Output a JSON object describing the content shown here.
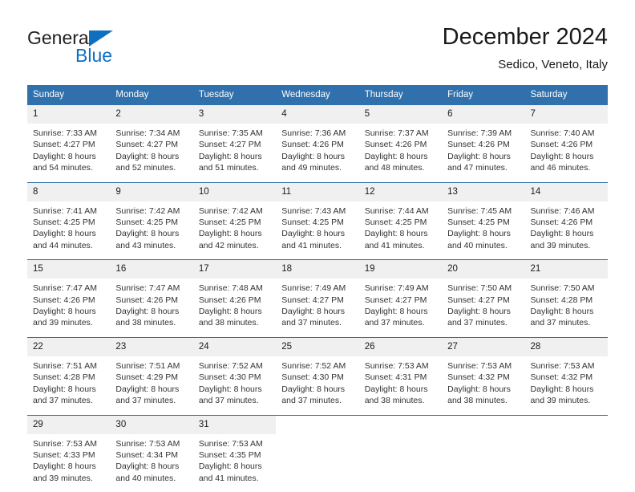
{
  "brand": {
    "name_top": "General",
    "name_bottom": "Blue",
    "triangle_color": "#0f6fc0"
  },
  "header": {
    "title": "December 2024",
    "subtitle": "Sedico, Veneto, Italy"
  },
  "theme": {
    "header_blue": "#3071ad",
    "day_number_band": "#f0f0f0",
    "text": "#333333"
  },
  "calendar": {
    "weekday_headers": [
      "Sunday",
      "Monday",
      "Tuesday",
      "Wednesday",
      "Thursday",
      "Friday",
      "Saturday"
    ],
    "weeks": [
      [
        {
          "day": "1",
          "sunrise": "Sunrise: 7:33 AM",
          "sunset": "Sunset: 4:27 PM",
          "daylight_1": "Daylight: 8 hours",
          "daylight_2": "and 54 minutes."
        },
        {
          "day": "2",
          "sunrise": "Sunrise: 7:34 AM",
          "sunset": "Sunset: 4:27 PM",
          "daylight_1": "Daylight: 8 hours",
          "daylight_2": "and 52 minutes."
        },
        {
          "day": "3",
          "sunrise": "Sunrise: 7:35 AM",
          "sunset": "Sunset: 4:27 PM",
          "daylight_1": "Daylight: 8 hours",
          "daylight_2": "and 51 minutes."
        },
        {
          "day": "4",
          "sunrise": "Sunrise: 7:36 AM",
          "sunset": "Sunset: 4:26 PM",
          "daylight_1": "Daylight: 8 hours",
          "daylight_2": "and 49 minutes."
        },
        {
          "day": "5",
          "sunrise": "Sunrise: 7:37 AM",
          "sunset": "Sunset: 4:26 PM",
          "daylight_1": "Daylight: 8 hours",
          "daylight_2": "and 48 minutes."
        },
        {
          "day": "6",
          "sunrise": "Sunrise: 7:39 AM",
          "sunset": "Sunset: 4:26 PM",
          "daylight_1": "Daylight: 8 hours",
          "daylight_2": "and 47 minutes."
        },
        {
          "day": "7",
          "sunrise": "Sunrise: 7:40 AM",
          "sunset": "Sunset: 4:26 PM",
          "daylight_1": "Daylight: 8 hours",
          "daylight_2": "and 46 minutes."
        }
      ],
      [
        {
          "day": "8",
          "sunrise": "Sunrise: 7:41 AM",
          "sunset": "Sunset: 4:25 PM",
          "daylight_1": "Daylight: 8 hours",
          "daylight_2": "and 44 minutes."
        },
        {
          "day": "9",
          "sunrise": "Sunrise: 7:42 AM",
          "sunset": "Sunset: 4:25 PM",
          "daylight_1": "Daylight: 8 hours",
          "daylight_2": "and 43 minutes."
        },
        {
          "day": "10",
          "sunrise": "Sunrise: 7:42 AM",
          "sunset": "Sunset: 4:25 PM",
          "daylight_1": "Daylight: 8 hours",
          "daylight_2": "and 42 minutes."
        },
        {
          "day": "11",
          "sunrise": "Sunrise: 7:43 AM",
          "sunset": "Sunset: 4:25 PM",
          "daylight_1": "Daylight: 8 hours",
          "daylight_2": "and 41 minutes."
        },
        {
          "day": "12",
          "sunrise": "Sunrise: 7:44 AM",
          "sunset": "Sunset: 4:25 PM",
          "daylight_1": "Daylight: 8 hours",
          "daylight_2": "and 41 minutes."
        },
        {
          "day": "13",
          "sunrise": "Sunrise: 7:45 AM",
          "sunset": "Sunset: 4:25 PM",
          "daylight_1": "Daylight: 8 hours",
          "daylight_2": "and 40 minutes."
        },
        {
          "day": "14",
          "sunrise": "Sunrise: 7:46 AM",
          "sunset": "Sunset: 4:26 PM",
          "daylight_1": "Daylight: 8 hours",
          "daylight_2": "and 39 minutes."
        }
      ],
      [
        {
          "day": "15",
          "sunrise": "Sunrise: 7:47 AM",
          "sunset": "Sunset: 4:26 PM",
          "daylight_1": "Daylight: 8 hours",
          "daylight_2": "and 39 minutes."
        },
        {
          "day": "16",
          "sunrise": "Sunrise: 7:47 AM",
          "sunset": "Sunset: 4:26 PM",
          "daylight_1": "Daylight: 8 hours",
          "daylight_2": "and 38 minutes."
        },
        {
          "day": "17",
          "sunrise": "Sunrise: 7:48 AM",
          "sunset": "Sunset: 4:26 PM",
          "daylight_1": "Daylight: 8 hours",
          "daylight_2": "and 38 minutes."
        },
        {
          "day": "18",
          "sunrise": "Sunrise: 7:49 AM",
          "sunset": "Sunset: 4:27 PM",
          "daylight_1": "Daylight: 8 hours",
          "daylight_2": "and 37 minutes."
        },
        {
          "day": "19",
          "sunrise": "Sunrise: 7:49 AM",
          "sunset": "Sunset: 4:27 PM",
          "daylight_1": "Daylight: 8 hours",
          "daylight_2": "and 37 minutes."
        },
        {
          "day": "20",
          "sunrise": "Sunrise: 7:50 AM",
          "sunset": "Sunset: 4:27 PM",
          "daylight_1": "Daylight: 8 hours",
          "daylight_2": "and 37 minutes."
        },
        {
          "day": "21",
          "sunrise": "Sunrise: 7:50 AM",
          "sunset": "Sunset: 4:28 PM",
          "daylight_1": "Daylight: 8 hours",
          "daylight_2": "and 37 minutes."
        }
      ],
      [
        {
          "day": "22",
          "sunrise": "Sunrise: 7:51 AM",
          "sunset": "Sunset: 4:28 PM",
          "daylight_1": "Daylight: 8 hours",
          "daylight_2": "and 37 minutes."
        },
        {
          "day": "23",
          "sunrise": "Sunrise: 7:51 AM",
          "sunset": "Sunset: 4:29 PM",
          "daylight_1": "Daylight: 8 hours",
          "daylight_2": "and 37 minutes."
        },
        {
          "day": "24",
          "sunrise": "Sunrise: 7:52 AM",
          "sunset": "Sunset: 4:30 PM",
          "daylight_1": "Daylight: 8 hours",
          "daylight_2": "and 37 minutes."
        },
        {
          "day": "25",
          "sunrise": "Sunrise: 7:52 AM",
          "sunset": "Sunset: 4:30 PM",
          "daylight_1": "Daylight: 8 hours",
          "daylight_2": "and 37 minutes."
        },
        {
          "day": "26",
          "sunrise": "Sunrise: 7:53 AM",
          "sunset": "Sunset: 4:31 PM",
          "daylight_1": "Daylight: 8 hours",
          "daylight_2": "and 38 minutes."
        },
        {
          "day": "27",
          "sunrise": "Sunrise: 7:53 AM",
          "sunset": "Sunset: 4:32 PM",
          "daylight_1": "Daylight: 8 hours",
          "daylight_2": "and 38 minutes."
        },
        {
          "day": "28",
          "sunrise": "Sunrise: 7:53 AM",
          "sunset": "Sunset: 4:32 PM",
          "daylight_1": "Daylight: 8 hours",
          "daylight_2": "and 39 minutes."
        }
      ],
      [
        {
          "day": "29",
          "sunrise": "Sunrise: 7:53 AM",
          "sunset": "Sunset: 4:33 PM",
          "daylight_1": "Daylight: 8 hours",
          "daylight_2": "and 39 minutes."
        },
        {
          "day": "30",
          "sunrise": "Sunrise: 7:53 AM",
          "sunset": "Sunset: 4:34 PM",
          "daylight_1": "Daylight: 8 hours",
          "daylight_2": "and 40 minutes."
        },
        {
          "day": "31",
          "sunrise": "Sunrise: 7:53 AM",
          "sunset": "Sunset: 4:35 PM",
          "daylight_1": "Daylight: 8 hours",
          "daylight_2": "and 41 minutes."
        },
        {
          "day": "",
          "sunrise": "",
          "sunset": "",
          "daylight_1": "",
          "daylight_2": ""
        },
        {
          "day": "",
          "sunrise": "",
          "sunset": "",
          "daylight_1": "",
          "daylight_2": ""
        },
        {
          "day": "",
          "sunrise": "",
          "sunset": "",
          "daylight_1": "",
          "daylight_2": ""
        },
        {
          "day": "",
          "sunrise": "",
          "sunset": "",
          "daylight_1": "",
          "daylight_2": ""
        }
      ]
    ]
  }
}
